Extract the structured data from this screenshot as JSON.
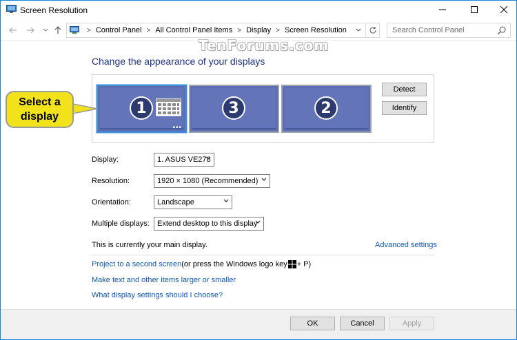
{
  "window": {
    "title": "Screen Resolution",
    "minimize": "—",
    "maximize": "☐",
    "close": "✕"
  },
  "nav": {
    "breadcrumbs": [
      "Control Panel",
      "All Control Panel Items",
      "Display",
      "Screen Resolution"
    ],
    "search_placeholder": "Search Control Panel"
  },
  "watermark": "TenForums.com",
  "heading": "Change the appearance of your displays",
  "monitors": [
    {
      "number": "1",
      "selected": true
    },
    {
      "number": "3",
      "selected": false
    },
    {
      "number": "2",
      "selected": false
    }
  ],
  "buttons": {
    "detect": "Detect",
    "identify": "Identify",
    "ok": "OK",
    "cancel": "Cancel",
    "apply": "Apply"
  },
  "callout": {
    "line1": "Select a",
    "line2": "display"
  },
  "fields": {
    "display_label": "Display:",
    "display_value": "1. ASUS VE278",
    "resolution_label": "Resolution:",
    "resolution_value": "1920 × 1080 (Recommended)",
    "orientation_label": "Orientation:",
    "orientation_value": "Landscape",
    "multiple_label": "Multiple displays:",
    "multiple_value": "Extend desktop to this display"
  },
  "main_display_text": "This is currently your main display.",
  "links": {
    "advanced": "Advanced settings",
    "project": "Project to a second screen",
    "project_suffix_1": " (or press the Windows logo key ",
    "project_suffix_2": " + P)",
    "text_size": "Make text and other items larger or smaller",
    "help": "What display settings should I choose?"
  },
  "colors": {
    "heading": "#1e3287",
    "link": "#0e55b3",
    "monitor": "#5d6eb3",
    "callout": "#f2e21b"
  }
}
